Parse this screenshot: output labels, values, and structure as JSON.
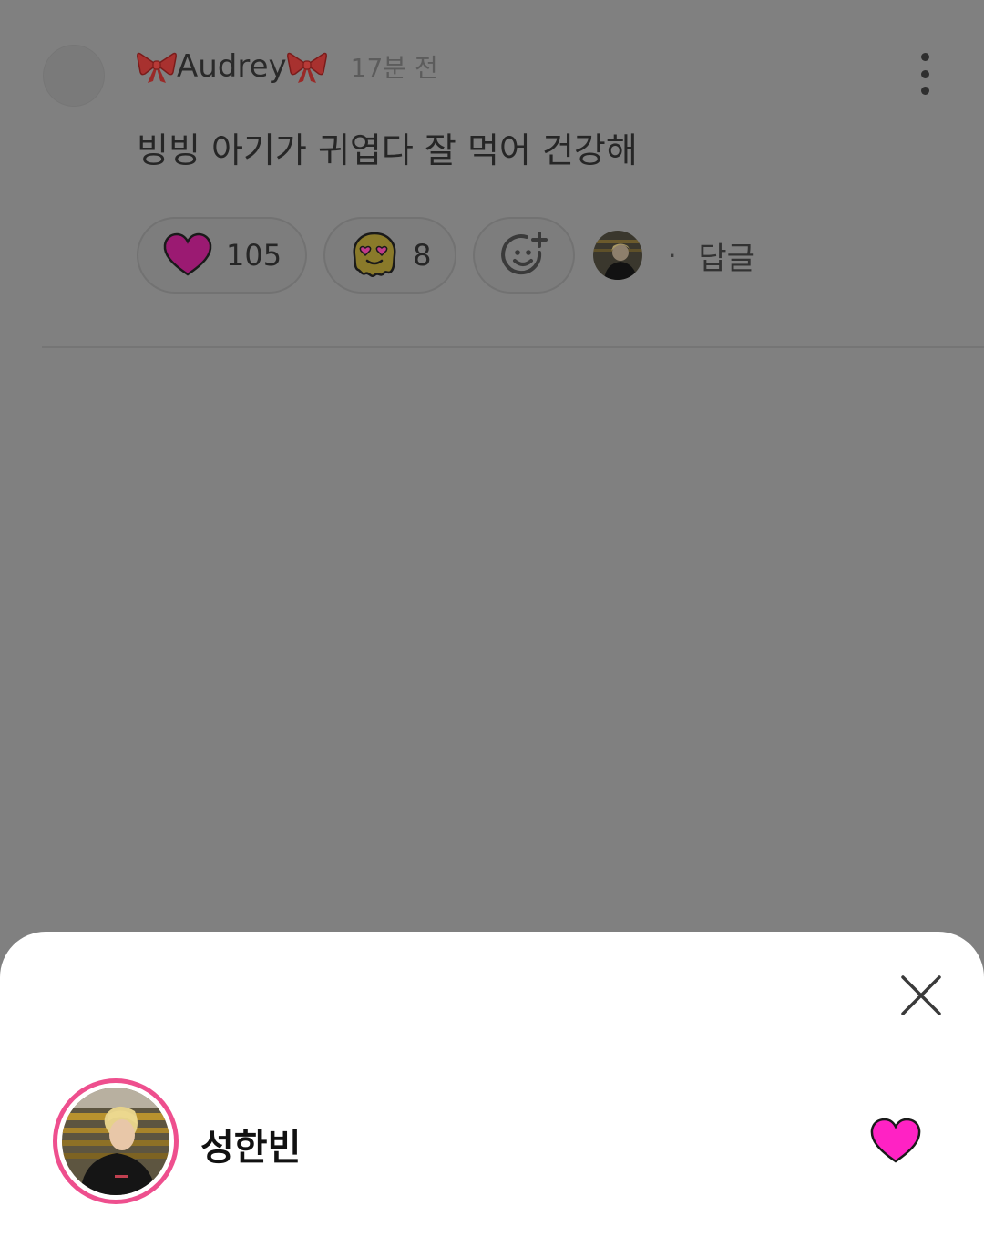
{
  "comment": {
    "username": "Audrey",
    "time": "17분 전",
    "text": "빙빙 아기가 귀엽다 잘 먹어 건강해",
    "reactions": [
      {
        "icon": "heart-icon",
        "count": "105",
        "color": "#9b1a72"
      },
      {
        "icon": "heart-eyes-blob-icon",
        "count": "8",
        "color": "#8a7a2a"
      }
    ],
    "reply_label": "답글",
    "separator": "·"
  },
  "sheet": {
    "user_name": "성한빈",
    "reaction_icon": "heart-icon",
    "reaction_color": "#ff22c4",
    "ring_color": "#ee4f8e"
  }
}
